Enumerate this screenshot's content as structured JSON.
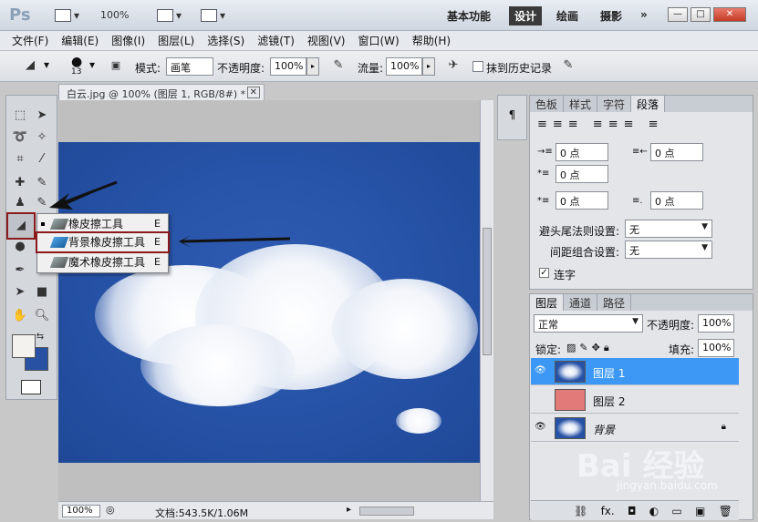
{
  "app": {
    "logo": "Ps",
    "zoom": "100%",
    "workspaces": [
      "基本功能",
      "设计",
      "绘画",
      "摄影"
    ],
    "active_workspace": "设计",
    "more": "»"
  },
  "menu": [
    "文件(F)",
    "编辑(E)",
    "图像(I)",
    "图层(L)",
    "选择(S)",
    "滤镜(T)",
    "视图(V)",
    "窗口(W)",
    "帮助(H)"
  ],
  "options": {
    "brush_size": "13",
    "mode_label": "模式:",
    "mode_value": "画笔",
    "opacity_label": "不透明度:",
    "opacity_value": "100%",
    "flow_label": "流量:",
    "flow_value": "100%",
    "history_label": "抹到历史记录"
  },
  "document": {
    "tab_title": "白云.jpg @ 100% (图层 1, RGB/8#) *",
    "status_zoom": "100%",
    "status_doc": "文档:543.5K/1.06M"
  },
  "flyout": {
    "items": [
      {
        "label": "橡皮擦工具",
        "key": "E"
      },
      {
        "label": "背景橡皮擦工具",
        "key": "E"
      },
      {
        "label": "魔术橡皮擦工具",
        "key": "E"
      }
    ]
  },
  "paragraph_panel": {
    "tabs": [
      "色板",
      "样式",
      "字符",
      "段落"
    ],
    "active_tab": "段落",
    "fields": {
      "indent_left": "0 点",
      "indent_right": "0 点",
      "indent_first": "0 点",
      "space_before": "0 点",
      "space_after": "0 点"
    },
    "avoid_label": "避头尾法则设置:",
    "avoid_value": "无",
    "spacing_label": "间距组合设置:",
    "spacing_value": "无",
    "hyphen_label": "连字"
  },
  "layers_panel": {
    "tabs": [
      "图层",
      "通道",
      "路径"
    ],
    "active_tab": "图层",
    "blend_mode": "正常",
    "opacity_label": "不透明度:",
    "opacity_value": "100%",
    "lock_label": "锁定:",
    "fill_label": "填充:",
    "fill_value": "100%",
    "layers": [
      {
        "name": "图层 1",
        "selected": true,
        "thumb": "cloud"
      },
      {
        "name": "图层 2",
        "selected": false,
        "thumb": "red"
      },
      {
        "name": "背景",
        "selected": false,
        "thumb": "cloud",
        "locked": true
      }
    ],
    "footer_icons": [
      "link-icon",
      "fx-icon",
      "mask-icon",
      "adjustment-icon",
      "group-icon",
      "new-layer-icon",
      "trash-icon"
    ],
    "footer_fx": "fx."
  },
  "colors": {
    "selection_blue": "#3d98f5",
    "highlight_red": "#8b1a1a",
    "layer2_thumb": "#e17a78",
    "background_swatch": "#2851a3"
  },
  "watermark": {
    "brand": "Bai 经验",
    "url": "jingyan.baidu.com"
  }
}
